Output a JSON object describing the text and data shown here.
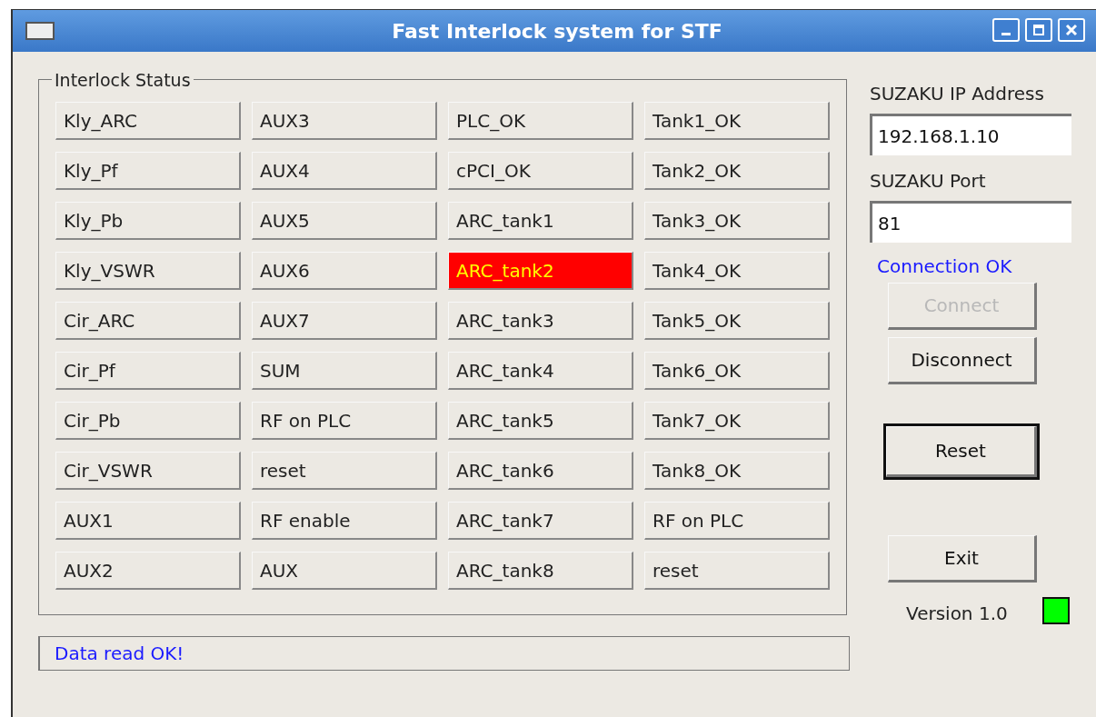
{
  "window": {
    "title": "Fast Interlock system for STF"
  },
  "interlock_status": {
    "title": "Interlock Status",
    "indicators": [
      {
        "label": "Kly_ARC",
        "alarm": false
      },
      {
        "label": "Kly_Pf",
        "alarm": false
      },
      {
        "label": "Kly_Pb",
        "alarm": false
      },
      {
        "label": "Kly_VSWR",
        "alarm": false
      },
      {
        "label": "Cir_ARC",
        "alarm": false
      },
      {
        "label": "Cir_Pf",
        "alarm": false
      },
      {
        "label": "Cir_Pb",
        "alarm": false
      },
      {
        "label": "Cir_VSWR",
        "alarm": false
      },
      {
        "label": "AUX1",
        "alarm": false
      },
      {
        "label": "AUX2",
        "alarm": false
      },
      {
        "label": "AUX3",
        "alarm": false
      },
      {
        "label": "AUX4",
        "alarm": false
      },
      {
        "label": "AUX5",
        "alarm": false
      },
      {
        "label": "AUX6",
        "alarm": false
      },
      {
        "label": "AUX7",
        "alarm": false
      },
      {
        "label": "SUM",
        "alarm": false
      },
      {
        "label": "RF on PLC",
        "alarm": false
      },
      {
        "label": "reset",
        "alarm": false
      },
      {
        "label": "RF enable",
        "alarm": false
      },
      {
        "label": "AUX",
        "alarm": false
      },
      {
        "label": "PLC_OK",
        "alarm": false
      },
      {
        "label": "cPCI_OK",
        "alarm": false
      },
      {
        "label": "ARC_tank1",
        "alarm": false
      },
      {
        "label": "ARC_tank2",
        "alarm": true
      },
      {
        "label": "ARC_tank3",
        "alarm": false
      },
      {
        "label": "ARC_tank4",
        "alarm": false
      },
      {
        "label": "ARC_tank5",
        "alarm": false
      },
      {
        "label": "ARC_tank6",
        "alarm": false
      },
      {
        "label": "ARC_tank7",
        "alarm": false
      },
      {
        "label": "ARC_tank8",
        "alarm": false
      },
      {
        "label": "Tank1_OK",
        "alarm": false
      },
      {
        "label": "Tank2_OK",
        "alarm": false
      },
      {
        "label": "Tank3_OK",
        "alarm": false
      },
      {
        "label": "Tank4_OK",
        "alarm": false
      },
      {
        "label": "Tank5_OK",
        "alarm": false
      },
      {
        "label": "Tank6_OK",
        "alarm": false
      },
      {
        "label": "Tank7_OK",
        "alarm": false
      },
      {
        "label": "Tank8_OK",
        "alarm": false
      },
      {
        "label": "RF on PLC",
        "alarm": false
      },
      {
        "label": "reset",
        "alarm": false
      }
    ]
  },
  "ip_address": {
    "label": "SUZAKU IP Address",
    "value": "192.168.1.10"
  },
  "port": {
    "label": "SUZAKU Port",
    "value": "81"
  },
  "connection_status": "Connection OK",
  "connect_buttons": [
    {
      "label": "Connect",
      "disabled": true
    },
    {
      "label": "Disconnect",
      "disabled": false
    }
  ],
  "reset_button": {
    "label": "Reset",
    "focused": true
  },
  "exit_button": {
    "label": "Exit"
  },
  "status_message": "Data read OK!",
  "version": "Version 1.0",
  "status_led": {
    "on": true
  }
}
